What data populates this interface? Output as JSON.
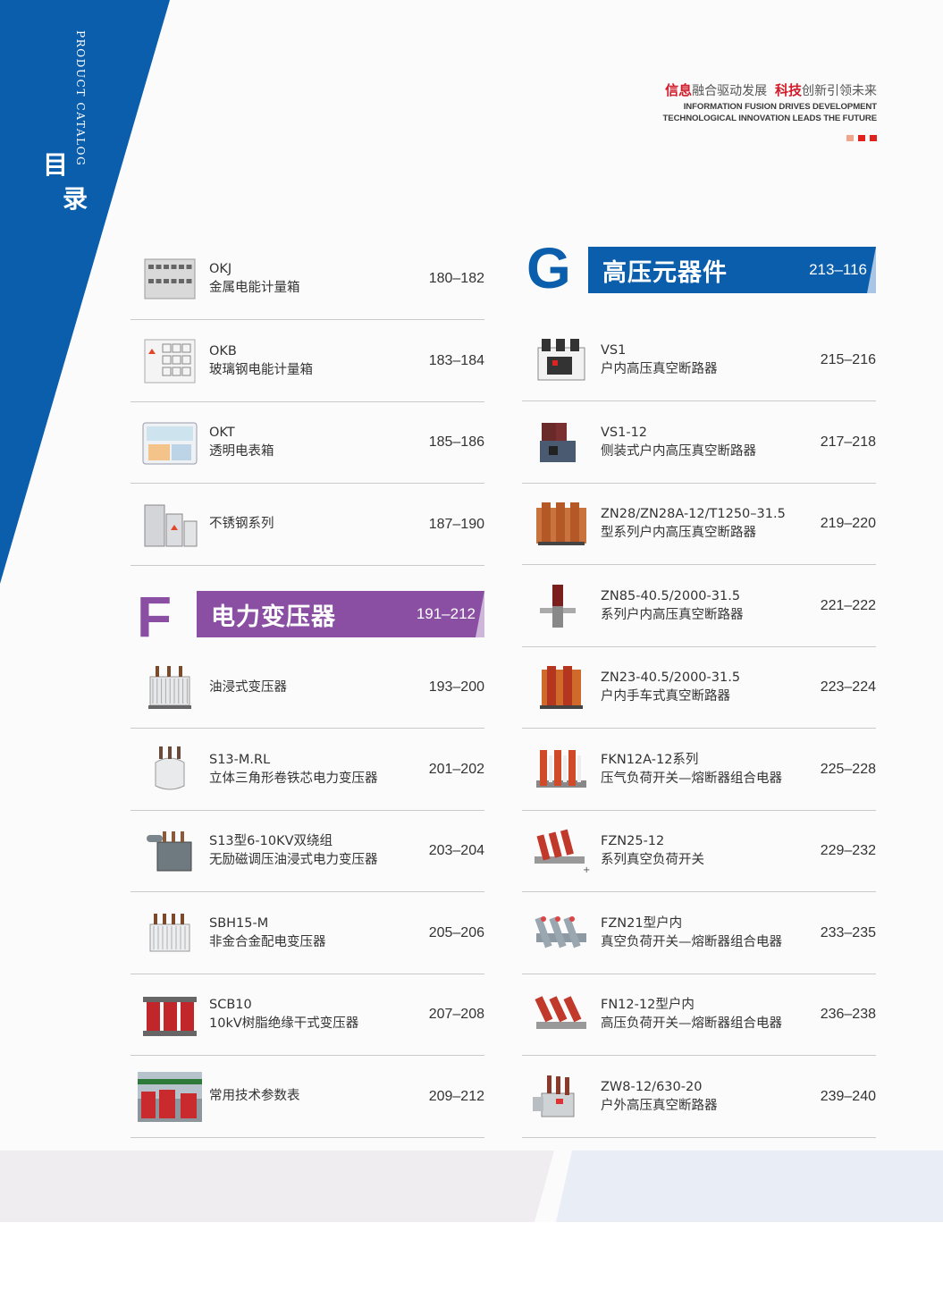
{
  "sidebar": {
    "catalog_en": "PRODUCT CATALOG",
    "title_char_1": "目",
    "title_char_2": "录"
  },
  "slogan": {
    "hl1": "信息",
    "t1": "融合驱动发展",
    "hl2": "科技",
    "t2": "创新引领未来",
    "en1": "INFORMATION FUSION DRIVES DEVELOPMENT",
    "en2": "TECHNOLOGICAL INNOVATION LEADS THE FUTURE",
    "dot_colors": [
      "#f0a68a",
      "#e2211c",
      "#e2211c"
    ]
  },
  "colors": {
    "blue": "#0b5eac",
    "purple": "#8a4fa3",
    "red": "#d11c2a"
  },
  "left_top": [
    {
      "line1": "OKJ",
      "line2": "金属电能计量箱",
      "pages": "180–182",
      "icon": "metal-meter-box-icon"
    },
    {
      "line1": "OKB",
      "line2": "玻璃钢电能计量箱",
      "pages": "183–184",
      "icon": "frp-meter-box-icon"
    },
    {
      "line1": "OKT",
      "line2": "透明电表箱",
      "pages": "185–186",
      "icon": "transparent-meter-box-icon"
    },
    {
      "line1": "",
      "line2": "不锈钢系列",
      "pages": "187–190",
      "icon": "stainless-cabinet-icon"
    }
  ],
  "section_f": {
    "letter": "F",
    "title": "电力变压器",
    "pages": "191–212"
  },
  "left_f": [
    {
      "line1": "",
      "line2": "油浸式变压器",
      "pages": "193–200",
      "icon": "oil-transformer-icon"
    },
    {
      "line1": "S13-M.RL",
      "line2": "立体三角形卷铁芯电力变压器",
      "pages": "201–202",
      "icon": "wound-core-transformer-icon"
    },
    {
      "line1": "S13型6-10KV双绕组",
      "line2": "无励磁调压油浸式电力变压器",
      "pages": "203–204",
      "icon": "oil-immersed-transformer-icon"
    },
    {
      "line1": "SBH15-M",
      "line2": "非金合金配电变压器",
      "pages": "205–206",
      "icon": "amorphous-transformer-icon"
    },
    {
      "line1": "SCB10",
      "line2": "10kV树脂绝缘干式变压器",
      "pages": "207–208",
      "icon": "dry-transformer-icon"
    },
    {
      "line1": "",
      "line2": "常用技术参数表",
      "pages": "209–212",
      "icon": "parameter-table-photo-icon"
    }
  ],
  "section_g": {
    "letter": "G",
    "title": "高压元器件",
    "pages": "213–116"
  },
  "right_g": [
    {
      "line1": "VS1",
      "line2": "户内高压真空断路器",
      "pages": "215–216",
      "icon": "vacuum-breaker-icon"
    },
    {
      "line1": "VS1-12",
      "line2": "侧装式户内高压真空断路器",
      "pages": "217–218",
      "icon": "side-breaker-icon"
    },
    {
      "line1": "ZN28/ZN28A-12/T1250–31.5",
      "line2": "型系列户内高压真空断路器",
      "pages": "219–220",
      "icon": "zn28-breaker-icon"
    },
    {
      "line1": "ZN85-40.5/2000-31.5",
      "line2": "系列户内高压真空断路器",
      "pages": "221–222",
      "icon": "zn85-breaker-icon"
    },
    {
      "line1": "ZN23-40.5/2000-31.5",
      "line2": "户内手车式真空断路器",
      "pages": "223–224",
      "icon": "zn23-breaker-icon"
    },
    {
      "line1": "FKN12A-12系列",
      "line2": "压气负荷开关—熔断器组合电器",
      "pages": "225–228",
      "icon": "fkn12-switch-icon"
    },
    {
      "line1": "FZN25-12",
      "line2": "系列真空负荷开关",
      "pages": "229–232",
      "icon": "fzn25-switch-icon"
    },
    {
      "line1": "FZN21型户内",
      "line2": "真空负荷开关—熔断器组合电器",
      "pages": "233–235",
      "icon": "fzn21-switch-icon"
    },
    {
      "line1": "FN12-12型户内",
      "line2": "高压负荷开关—熔断器组合电器",
      "pages": "236–238",
      "icon": "fn12-switch-icon"
    },
    {
      "line1": "ZW8-12/630-20",
      "line2": "户外高压真空断路器",
      "pages": "239–240",
      "icon": "outdoor-breaker-icon"
    }
  ]
}
